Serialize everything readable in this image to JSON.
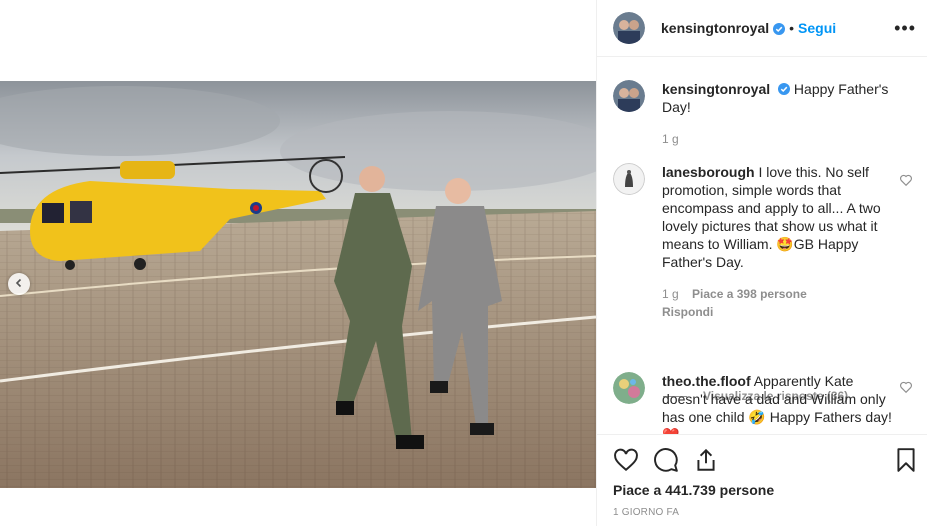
{
  "post": {
    "author": "kensingtonroyal",
    "follow_label": "Segui",
    "separator": "•",
    "more_label": "•••",
    "caption": "Happy Father's Day!",
    "caption_time": "1 g"
  },
  "comments": [
    {
      "user": "lanesborough",
      "text": "I love this. No self promotion, simple words that encompass and apply to all... A two lovely pictures that show us what it means to William. 🤩GB Happy Father's Day.",
      "time": "1 g",
      "likes": "Piace a 398 persone",
      "reply": "Rispondi",
      "view_replies": "Visualizza le risposte (36)"
    },
    {
      "user": "theo.the.floof",
      "text": "Apparently Kate doesn't have a dad and William only has one child 🤣 Happy Fathers day! ❤️"
    }
  ],
  "footer": {
    "likes": "Piace a 441.739 persone",
    "time": "1 GIORNO FA"
  },
  "icons": {
    "prev": "chevron-left-icon",
    "like": "heart-icon",
    "comment": "comment-icon",
    "share": "share-icon",
    "save": "bookmark-icon"
  },
  "colors": {
    "accent": "#0095f6",
    "verified": "#3897f0",
    "text": "#262626",
    "muted": "#8e8e8e"
  }
}
